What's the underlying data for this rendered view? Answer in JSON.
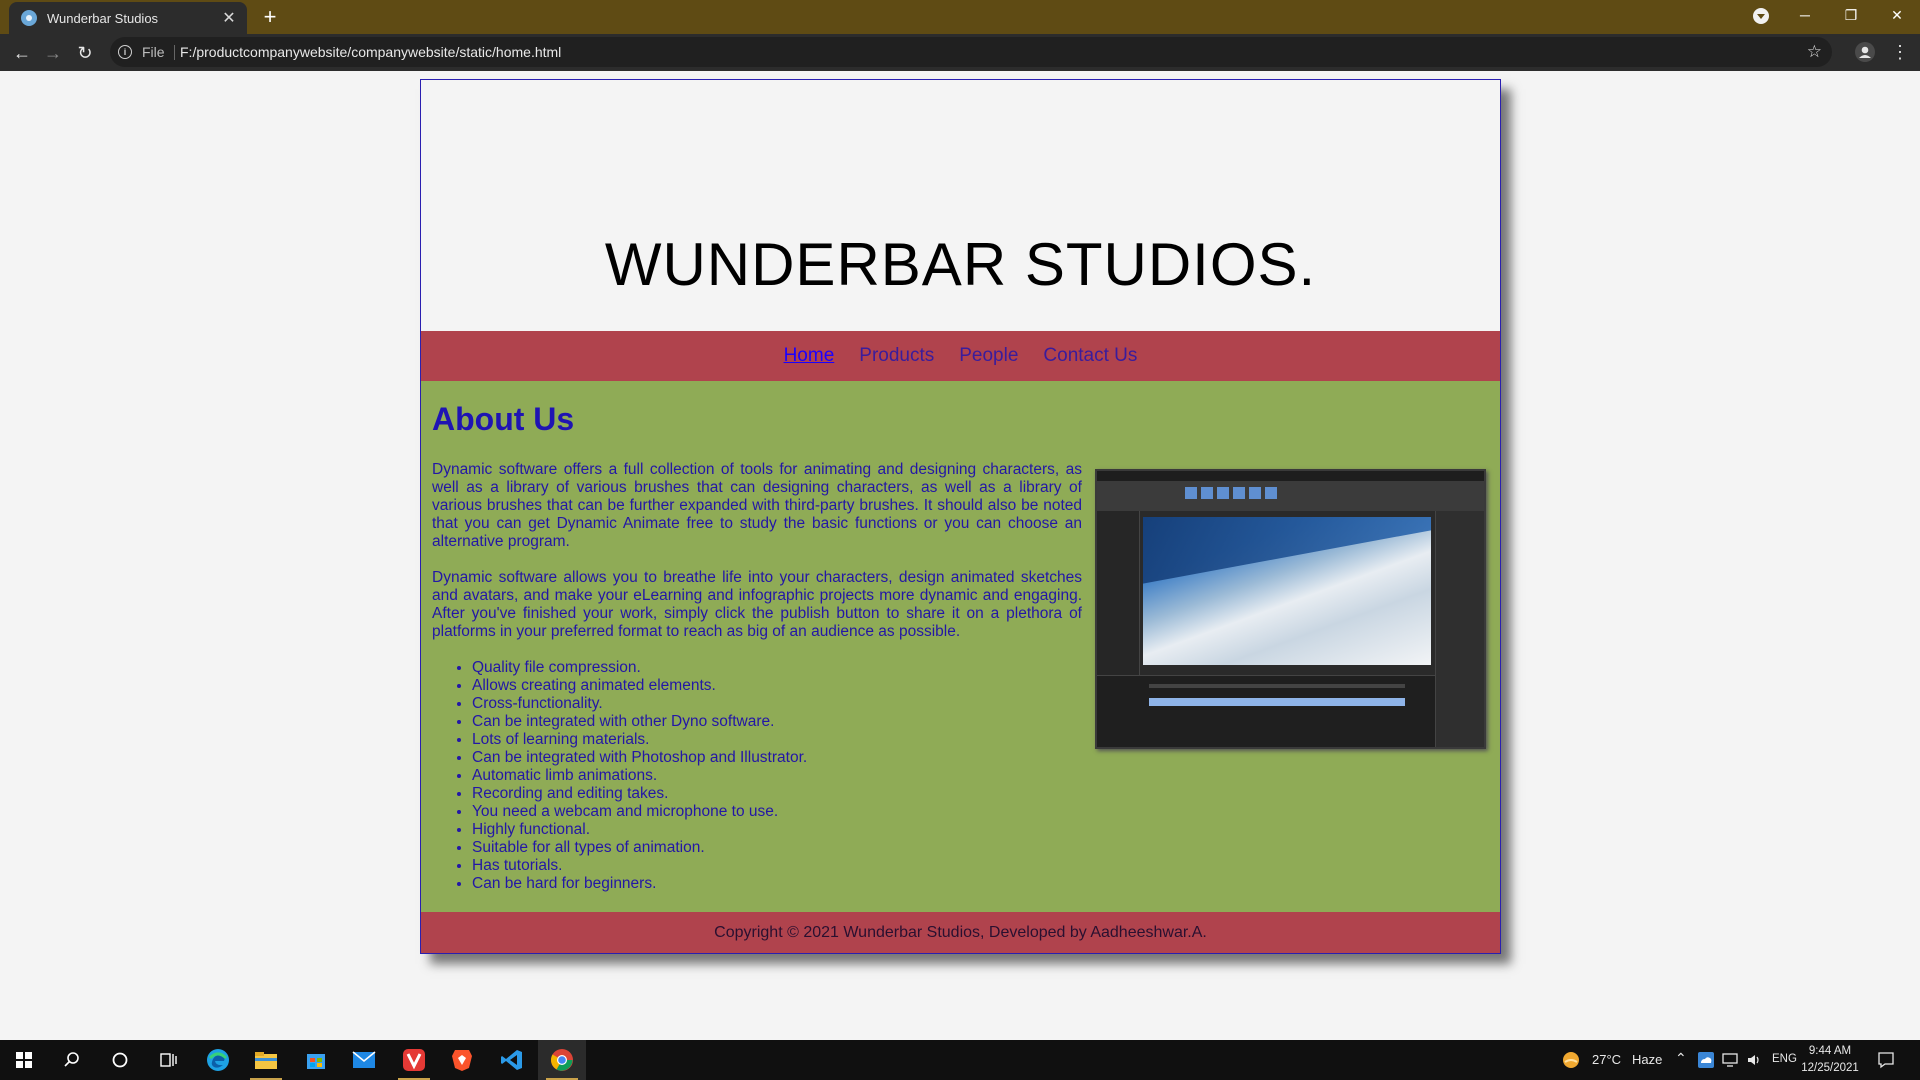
{
  "browser": {
    "tab": {
      "title": "Wunderbar Studios"
    },
    "address": {
      "scheme_label": "File",
      "url": "F:/productcompanywebsite/companywebsite/static/home.html"
    },
    "window_controls": {
      "minimize": "─",
      "restore": "❐",
      "close": "✕"
    }
  },
  "site": {
    "title": "WUNDERBAR STUDIOS.",
    "nav": [
      {
        "label": "Home",
        "active": true
      },
      {
        "label": "Products",
        "active": false
      },
      {
        "label": "People",
        "active": false
      },
      {
        "label": "Contact Us",
        "active": false
      }
    ],
    "about": {
      "heading": "About Us",
      "paragraphs": [
        "Dynamic software offers a full collection of tools for animating and designing characters, as well as a library of various brushes that can designing characters, as well as a library of various brushes that can be further expanded with third-party brushes. It should also be noted that you can get Dynamic Animate free to study the basic functions or you can choose an alternative program.",
        "Dynamic software allows you to breathe life into your characters, design animated sketches and avatars, and make your eLearning and infographic projects more dynamic and engaging. After you've finished your work, simply click the publish button to share it on a plethora of platforms in your preferred format to reach as big of an audience as possible."
      ],
      "features": [
        "Quality file compression.",
        "Allows creating animated elements.",
        "Cross-functionality.",
        "Can be integrated with other Dyno software.",
        "Lots of learning materials.",
        "Can be integrated with Photoshop and Illustrator.",
        "Automatic limb animations.",
        "Recording and editing takes.",
        "You need a webcam and microphone to use.",
        "Highly functional.",
        "Suitable for all types of animation.",
        "Has tutorials.",
        "Can be hard for beginners."
      ]
    },
    "footer": "Copyright © 2021 Wunderbar Studios, Developed by Aadheeshwar.A."
  },
  "taskbar": {
    "weather": {
      "temp": "27°C",
      "condition": "Haze"
    },
    "language": "ENG",
    "clock": {
      "time": "9:44 AM",
      "date": "12/25/2021"
    }
  },
  "colors": {
    "header_bg": "#f4f4f4",
    "nav_bg": "#b0434d",
    "main_bg": "#8fab56",
    "text": "#2317a6",
    "tabbar": "#5f4b14"
  }
}
